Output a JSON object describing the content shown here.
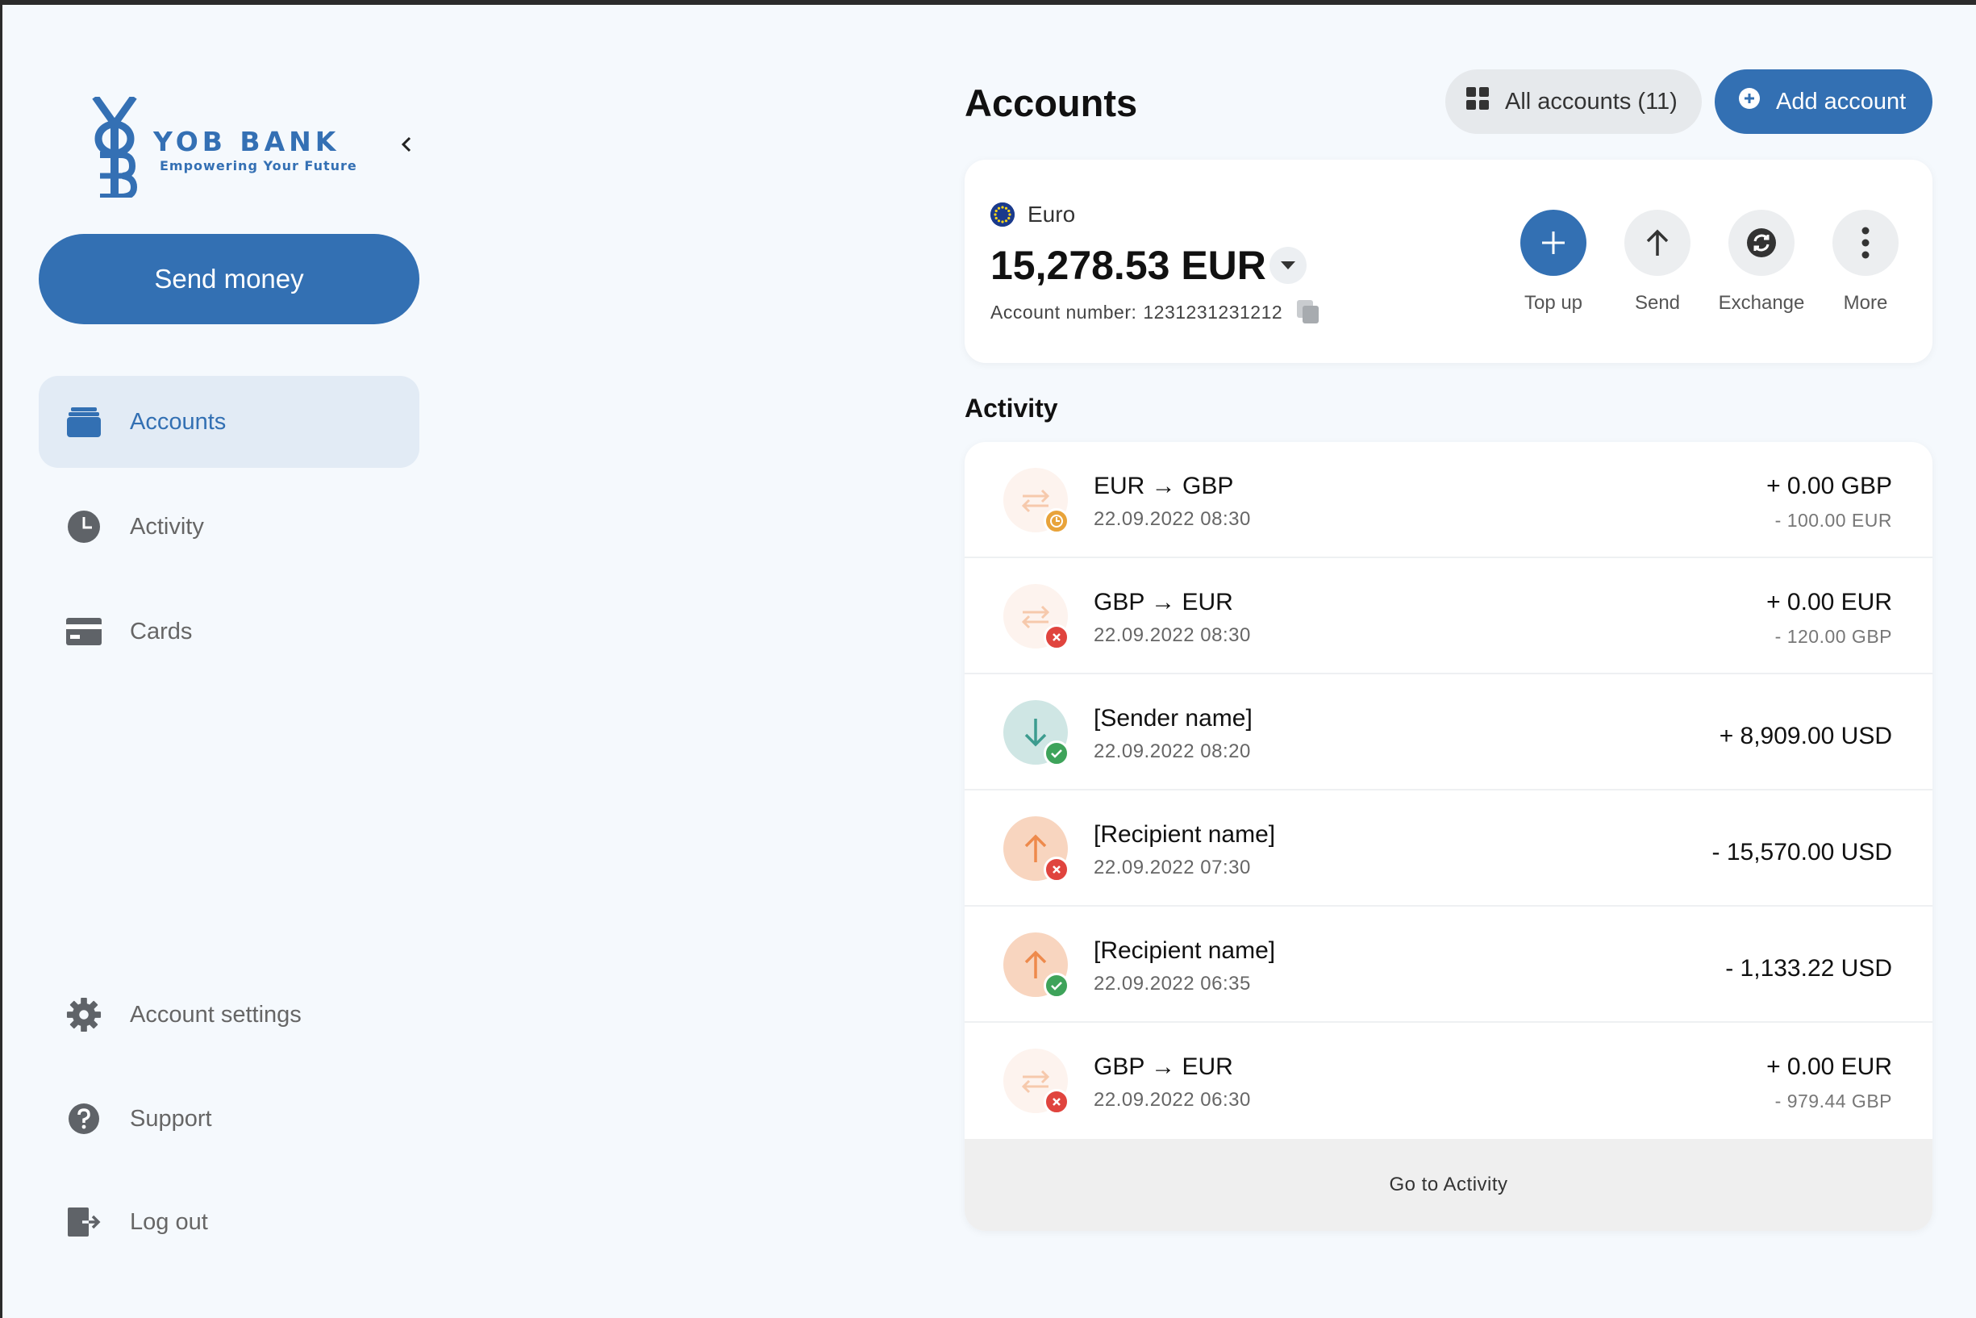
{
  "brand": {
    "name": "YOB BANK",
    "tagline": "Empowering Your Future",
    "color": "#3470b4"
  },
  "sidebar": {
    "send_money_label": "Send money",
    "items": [
      {
        "label": "Accounts",
        "icon": "wallet-icon",
        "active": true
      },
      {
        "label": "Activity",
        "icon": "clock-icon",
        "active": false
      },
      {
        "label": "Cards",
        "icon": "credit-card-icon",
        "active": false
      }
    ],
    "bottom_items": [
      {
        "label": "Account settings",
        "icon": "gear-icon"
      },
      {
        "label": "Support",
        "icon": "help-icon"
      },
      {
        "label": "Log out",
        "icon": "logout-icon"
      }
    ]
  },
  "header": {
    "title": "Accounts",
    "all_accounts_label": "All accounts (11)",
    "add_account_label": "Add account"
  },
  "account": {
    "currency_name": "Euro",
    "balance": "15,278.53 EUR",
    "account_number_label": "Account number:",
    "account_number": "1231231231212",
    "actions": [
      {
        "label": "Top up",
        "icon": "plus-icon",
        "primary": true
      },
      {
        "label": "Send",
        "icon": "arrow-up-icon",
        "primary": false
      },
      {
        "label": "Exchange",
        "icon": "exchange-icon",
        "primary": false
      },
      {
        "label": "More",
        "icon": "more-vertical-icon",
        "primary": false
      }
    ]
  },
  "activity": {
    "title": "Activity",
    "go_to_label": "Go to Activity",
    "transactions": [
      {
        "title": "EUR → GBP",
        "date": "22.09.2022 08:30",
        "amount": "+ 0.00 GBP",
        "sub_amount": "- 100.00 EUR",
        "type": "exchange",
        "status": "pending"
      },
      {
        "title": "GBP → EUR",
        "date": "22.09.2022 08:30",
        "amount": "+ 0.00 EUR",
        "sub_amount": "- 120.00 GBP",
        "type": "exchange",
        "status": "failed"
      },
      {
        "title": "[Sender name]",
        "date": "22.09.2022 08:20",
        "amount": "+ 8,909.00 USD",
        "sub_amount": "",
        "type": "incoming",
        "status": "success"
      },
      {
        "title": "[Recipient name]",
        "date": "22.09.2022 07:30",
        "amount": "- 15,570.00 USD",
        "sub_amount": "",
        "type": "outgoing",
        "status": "failed"
      },
      {
        "title": "[Recipient name]",
        "date": "22.09.2022 06:35",
        "amount": "- 1,133.22 USD",
        "sub_amount": "",
        "type": "outgoing",
        "status": "success"
      },
      {
        "title": "GBP → EUR",
        "date": "22.09.2022 06:30",
        "amount": "+ 0.00 EUR",
        "sub_amount": "- 979.44 GBP",
        "type": "exchange",
        "status": "failed"
      }
    ]
  },
  "colors": {
    "primary": "#3370b3",
    "status_pending": "#e8a33a",
    "status_failed": "#e0443e",
    "status_success": "#3ea35a",
    "incoming_bg": "#cfe6e4",
    "incoming_fg": "#3d9c8f",
    "outgoing_bg": "#f8d5bf",
    "outgoing_fg": "#ee8a4c"
  }
}
